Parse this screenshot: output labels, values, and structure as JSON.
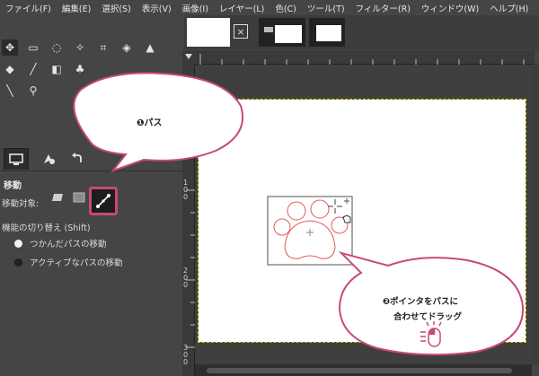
{
  "menubar": {
    "items": [
      "ファイル(F)",
      "編集(E)",
      "選択(S)",
      "表示(V)",
      "画像(I)",
      "レイヤー(L)",
      "色(C)",
      "ツール(T)",
      "フィルター(R)",
      "ウィンドウ(W)",
      "ヘルプ(H)"
    ]
  },
  "tool_options": {
    "title": "移動",
    "mode_label": "移動対象:",
    "toggle_label": "機能の切り替え (Shift)",
    "radio_1": "つかんだパスの移動",
    "radio_2": "アクティブなパスの移動"
  },
  "thumbbar": {
    "close_glyph": "×"
  },
  "rulers": {
    "left_100": "100",
    "left_200": "200",
    "left_300": "300"
  },
  "callouts": {
    "path_label": "❶パス",
    "drag_line1": "❷ポインタをパスに",
    "drag_line2": "合わせてドラッグ"
  },
  "colors": {
    "accent": "#c8487a",
    "canvas": "#ffffff",
    "path_stroke": "#e45a5a"
  }
}
